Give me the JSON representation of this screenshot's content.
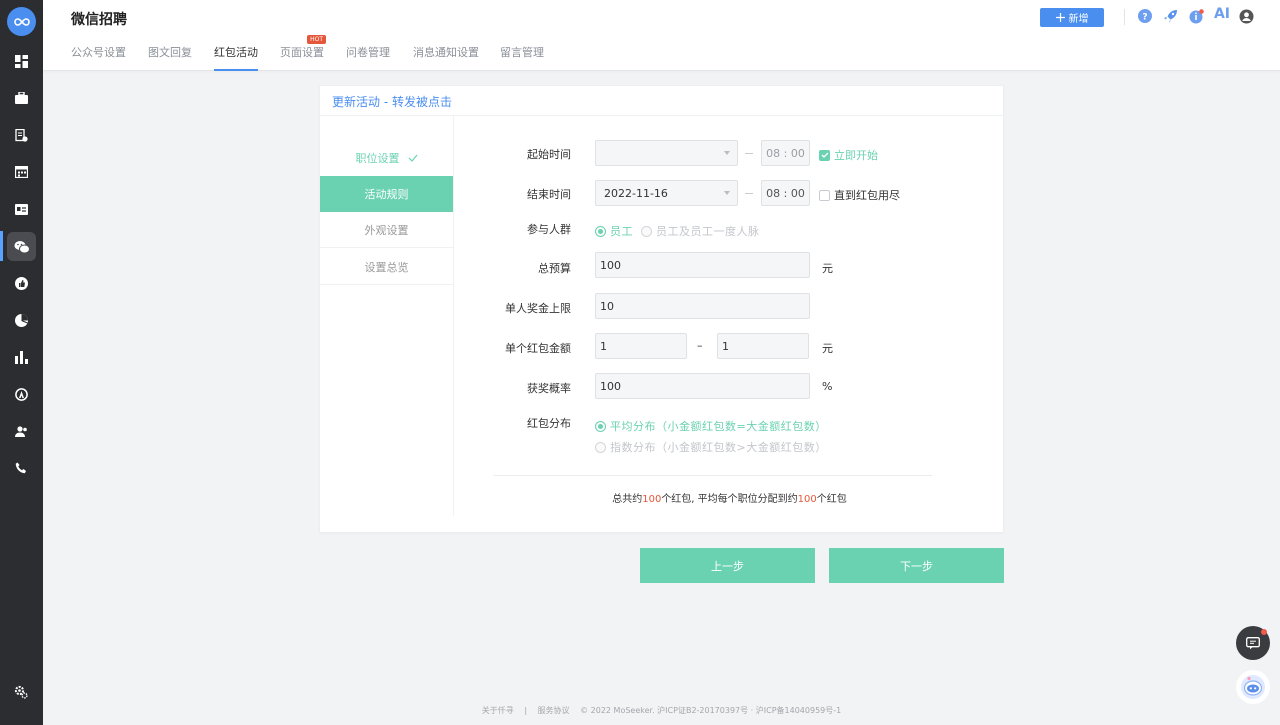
{
  "header": {
    "title": "微信招聘",
    "add_label": "新增",
    "icons": [
      "help-icon",
      "rocket-icon",
      "info-icon",
      "ai-icon",
      "user-icon"
    ],
    "ai_label": "AI",
    "tabs": [
      {
        "label": "公众号设置"
      },
      {
        "label": "图文回复"
      },
      {
        "label": "红包活动",
        "active": true
      },
      {
        "label": "页面设置",
        "badge": "HOT"
      },
      {
        "label": "问卷管理"
      },
      {
        "label": "消息通知设置"
      },
      {
        "label": "留言管理"
      }
    ]
  },
  "sidebar": {
    "icons": [
      "logo-icon",
      "dashboard-icon",
      "briefcase-icon",
      "document-icon",
      "calendar-icon",
      "id-card-icon",
      "wechat-icon",
      "thumbs-up-icon",
      "pie-chart-icon",
      "bar-chart-icon",
      "badge-icon",
      "people-icon",
      "phone-icon",
      "settings-icon"
    ],
    "logo_text": "MoSeeker"
  },
  "card": {
    "title": "更新活动 - 转发被点击",
    "steps": [
      {
        "label": "职位设置",
        "state": "done"
      },
      {
        "label": "活动规则",
        "state": "active"
      },
      {
        "label": "外观设置",
        "state": "todo"
      },
      {
        "label": "设置总览",
        "state": "todo"
      }
    ],
    "form": {
      "start_label": "起始时间",
      "start_date": "",
      "start_time": "08 : 00",
      "start_now_label": "立即开始",
      "end_label": "结束时间",
      "end_date": "2022-11-16",
      "end_time": "08 : 00",
      "end_until_label": "直到红包用尽",
      "audience_label": "参与人群",
      "audience_opt1": "员工",
      "audience_opt2": "员工及员工一度人脉",
      "budget_label": "总预算",
      "budget_value": "100",
      "budget_unit": "元",
      "cap_label": "单人奖金上限",
      "cap_value": "10",
      "amount_label": "单个红包金额",
      "amount_min": "1",
      "amount_sep": "–",
      "amount_max": "1",
      "amount_unit": "元",
      "prob_label": "获奖概率",
      "prob_value": "100",
      "prob_unit": "%",
      "dist_label": "红包分布",
      "dist_opt1": "平均分布（小金额红包数=大金额红包数）",
      "dist_opt2": "指数分布（小金额红包数>大金额红包数）"
    },
    "summary": {
      "p1": "总共约",
      "n1": "100",
      "p2": "个红包, 平均每个职位分配到约",
      "n2": "100",
      "p3": "个红包"
    }
  },
  "nav": {
    "prev_label": "上一步",
    "next_label": "下一步"
  },
  "footer": {
    "about": "关于仟寻",
    "sep": "|",
    "terms": "服务协议",
    "copyright": "© 2022 MoSeeker. 沪ICP证B2-20170397号 · 沪ICP备14040959号-1"
  },
  "colors": {
    "accent": "#4a8ef0",
    "green": "#6bd2b1",
    "red": "#e5573b",
    "rail": "#2b2d31"
  }
}
